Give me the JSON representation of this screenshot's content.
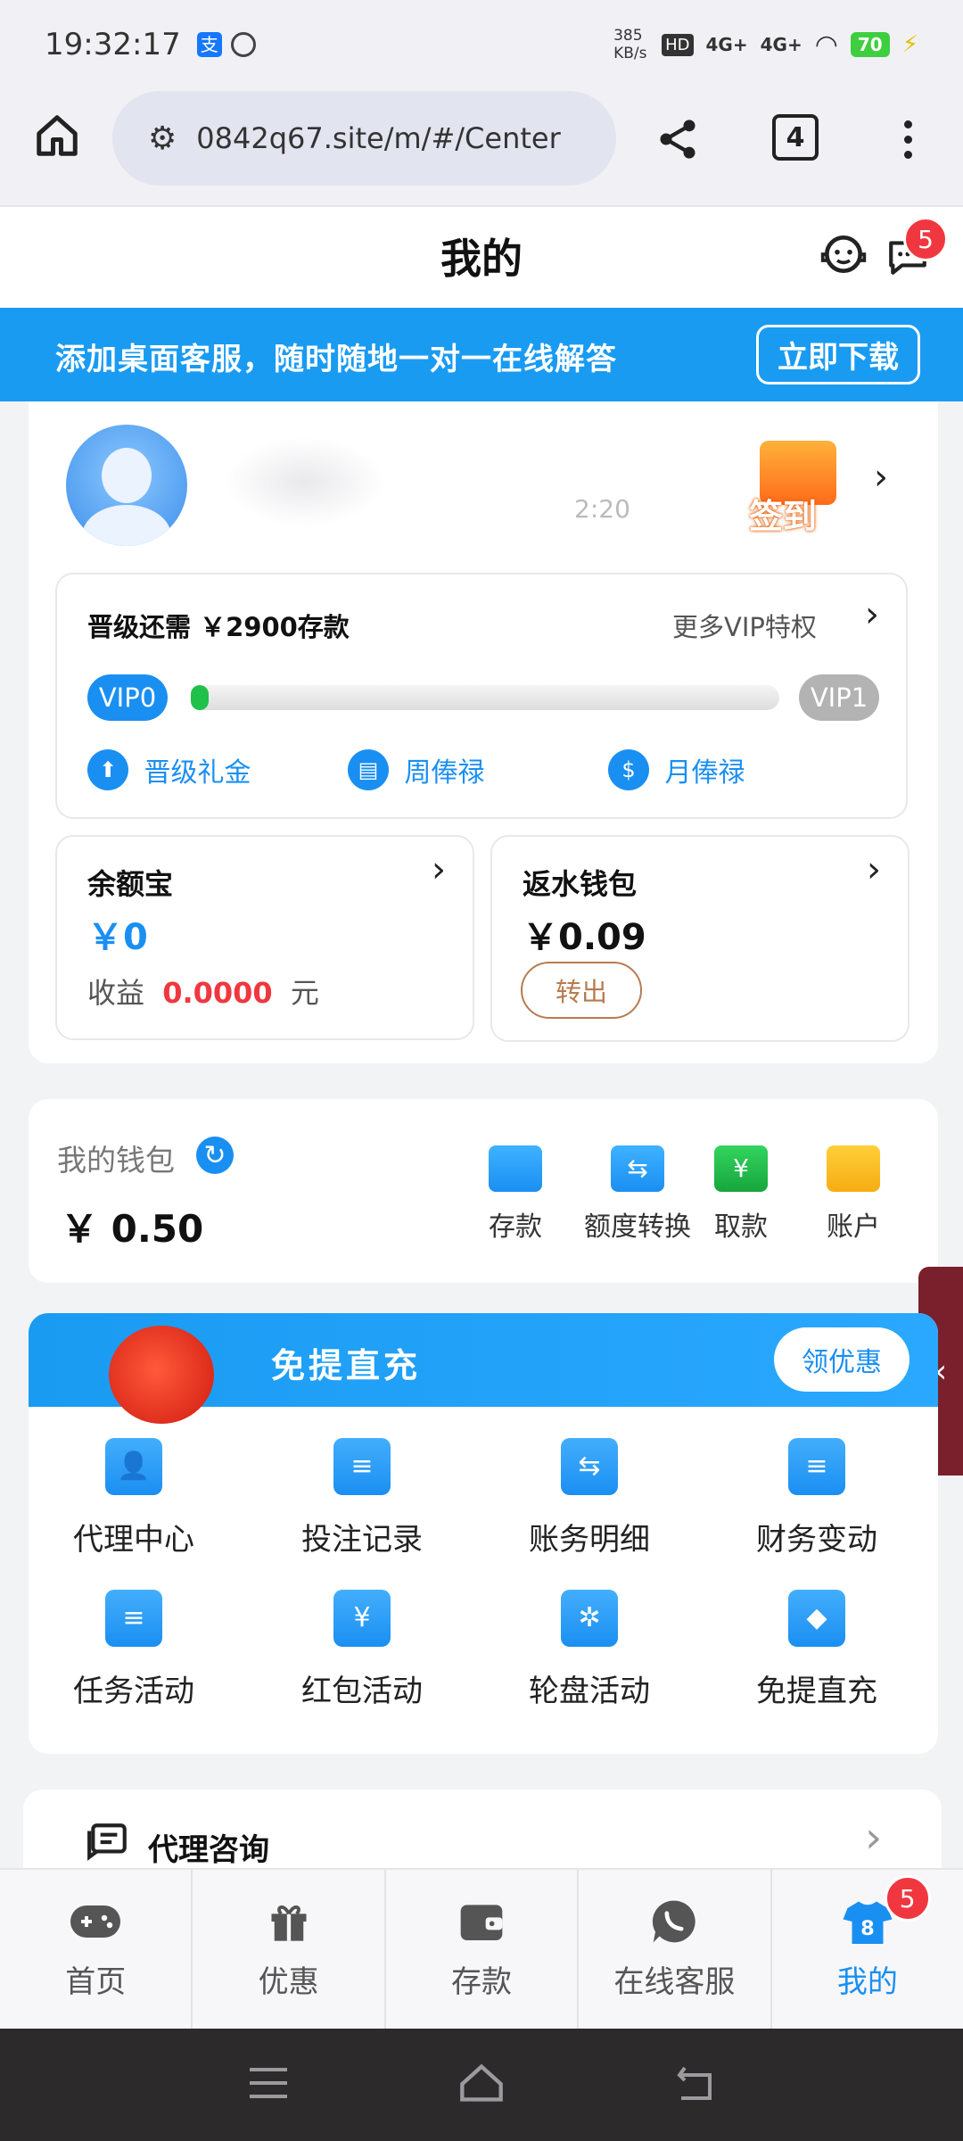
{
  "status_bar": {
    "time": "19:32:17",
    "net_speed": "385 KB/s",
    "signal_1": "4G+",
    "signal_2": "4G+",
    "battery": "70"
  },
  "browser": {
    "url": "0842q67.site/m/#/Center",
    "tab_count": "4"
  },
  "header": {
    "title": "我的",
    "message_badge": "5"
  },
  "promo_banner": {
    "text": "添加桌面客服，随时随地一对一在线解答",
    "button": "立即下载"
  },
  "profile": {
    "time_fragment": "2:20",
    "signin_label": "签到"
  },
  "vip": {
    "requirement": "晋级还需 ￥2900存款",
    "more_link": "更多VIP特权",
    "current_level": "VIP0",
    "next_level": "VIP1",
    "progress": 0.02,
    "perks": [
      "晋级礼金",
      "周俸禄",
      "月俸禄"
    ]
  },
  "yuebao": {
    "title": "余额宝",
    "amount": "￥0",
    "income_label": "收益",
    "income_value": "0.0000",
    "income_unit": "元"
  },
  "rebate_wallet": {
    "title": "返水钱包",
    "amount": "￥0.09",
    "button": "转出"
  },
  "wallet": {
    "label": "我的钱包",
    "balance": "￥ 0.50",
    "actions": [
      {
        "label": "存款",
        "color": "#1a9bf2"
      },
      {
        "label": "额度转换",
        "color": "#1a9bf2"
      },
      {
        "label": "取款",
        "color": "#1fb84a"
      },
      {
        "label": "账户",
        "color": "#f7b81c"
      }
    ]
  },
  "recharge_banner": {
    "title": "免提直充",
    "button": "领优惠"
  },
  "features": [
    {
      "label": "代理中心",
      "icon": "agent-icon"
    },
    {
      "label": "投注记录",
      "icon": "bet-record-icon"
    },
    {
      "label": "账务明细",
      "icon": "ledger-icon"
    },
    {
      "label": "财务变动",
      "icon": "finance-change-icon"
    },
    {
      "label": "任务活动",
      "icon": "task-icon"
    },
    {
      "label": "红包活动",
      "icon": "red-envelope-icon"
    },
    {
      "label": "轮盘活动",
      "icon": "wheel-icon"
    },
    {
      "label": "免提直充",
      "icon": "recharge-icon"
    }
  ],
  "consult": {
    "label": "代理咨询"
  },
  "tabs": [
    {
      "label": "首页",
      "icon": "gamepad-icon"
    },
    {
      "label": "优惠",
      "icon": "gift-icon"
    },
    {
      "label": "存款",
      "icon": "wallet-icon"
    },
    {
      "label": "在线客服",
      "icon": "chat-icon"
    },
    {
      "label": "我的",
      "icon": "shirt-icon",
      "badge": "5",
      "active": true
    }
  ],
  "colors": {
    "primary": "#1a9bf2",
    "danger": "#f0373f",
    "side_tab": "#7a1f2c"
  }
}
